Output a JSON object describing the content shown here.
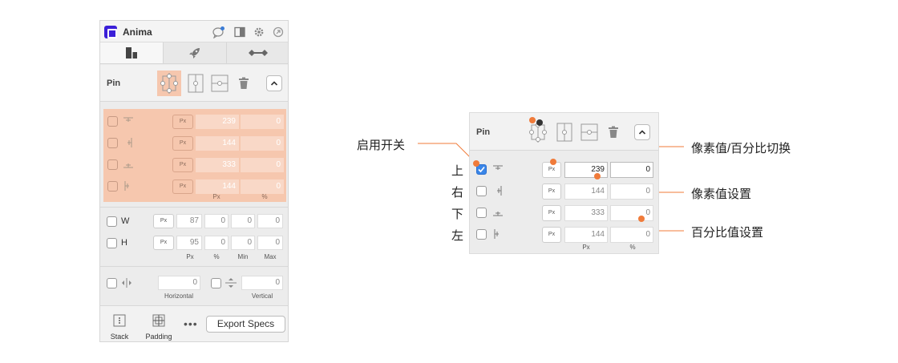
{
  "app": {
    "title": "Anima"
  },
  "colors": {
    "accent": "#f07b3a",
    "brand": "#3b1fd8",
    "highlight": "#f6c7ae"
  },
  "pin": {
    "label": "Pin",
    "rows": [
      {
        "side": "top",
        "unit": "Px",
        "value": "239",
        "percent": "0"
      },
      {
        "side": "right",
        "unit": "Px",
        "value": "144",
        "percent": "0"
      },
      {
        "side": "bottom",
        "unit": "Px",
        "value": "333",
        "percent": "0"
      },
      {
        "side": "left",
        "unit": "Px",
        "value": "144",
        "percent": "0"
      }
    ],
    "col_px": "Px",
    "col_percent": "%"
  },
  "size": {
    "w_label": "W",
    "h_label": "H",
    "w": {
      "unit": "Px",
      "value": "87",
      "percent": "0",
      "min": "0",
      "max": "0"
    },
    "h": {
      "unit": "Px",
      "value": "95",
      "percent": "0",
      "min": "0",
      "max": "0"
    },
    "col_px": "Px",
    "col_percent": "%",
    "col_min": "Min",
    "col_max": "Max"
  },
  "distribute": {
    "horizontal_value": "0",
    "vertical_value": "0",
    "horizontal_label": "Horizontal",
    "vertical_label": "Vertical"
  },
  "bottom": {
    "stack": "Stack",
    "padding": "Padding",
    "more": "•••",
    "export": "Export Specs"
  },
  "zoom": {
    "label": "Pin",
    "rows": [
      {
        "unit": "Px",
        "value": "239",
        "percent": "0",
        "checked": true
      },
      {
        "unit": "Px",
        "value": "144",
        "percent": "0",
        "checked": false
      },
      {
        "unit": "Px",
        "value": "333",
        "percent": "0",
        "checked": false
      },
      {
        "unit": "Px",
        "value": "144",
        "percent": "0",
        "checked": false
      }
    ],
    "col_px": "Px",
    "col_percent": "%"
  },
  "annotations": {
    "side_top": "上",
    "side_right": "右",
    "side_bottom": "下",
    "side_left": "左",
    "enable_switch": "启用开关",
    "unit_toggle": "像素值/百分比切换",
    "pixel_setting": "像素值设置",
    "percent_setting": "百分比值设置"
  }
}
